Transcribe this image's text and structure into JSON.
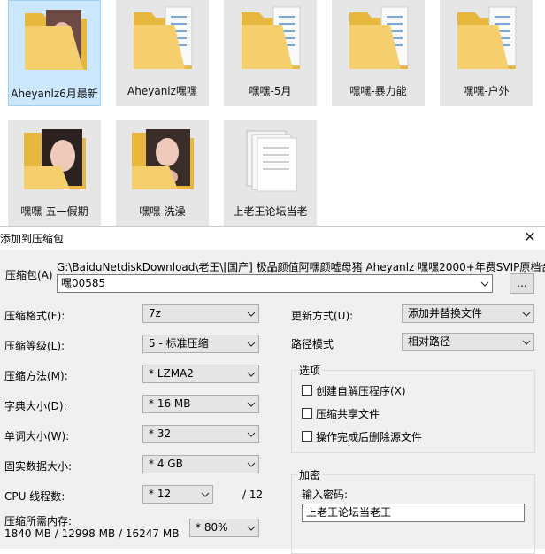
{
  "explorer": {
    "items": [
      {
        "label": "Aheyanlz6月最新",
        "icon": "folder-photo-icon"
      },
      {
        "label": "Aheyanlz嘿嘿",
        "icon": "folder-doc-icon"
      },
      {
        "label": "嘿嘿-5月",
        "icon": "folder-doc-icon"
      },
      {
        "label": "嘿嘿-暴力能",
        "icon": "folder-doc-icon"
      },
      {
        "label": "嘿嘿-户外",
        "icon": "folder-doc-icon"
      },
      {
        "label": "嘿嘿-五一假期",
        "icon": "folder-photo-icon"
      },
      {
        "label": "嘿嘿-洗澡",
        "icon": "folder-photo-icon"
      },
      {
        "label": "上老王论坛当老",
        "icon": "file-stack-icon"
      }
    ]
  },
  "dialog": {
    "title": "添加到压缩包",
    "archive_label": "压缩包(A)",
    "archive_path": "G:\\BaiduNetdiskDownload\\老王\\[国产] 极品颜值阿嘿颜嘘母猪 Aheyanlz 嘿嘿2000+年费SVIP原档合集【",
    "archive_name": "嘿00585",
    "browse_button": "...",
    "format_label": "压缩格式(F):",
    "format_value": "7z",
    "level_label": "压缩等级(L):",
    "level_value": "5 - 标准压缩",
    "method_label": "压缩方法(M):",
    "method_value": "*  LZMA2",
    "dict_label": "字典大小(D):",
    "dict_value": "*  16 MB",
    "word_label": "单词大小(W):",
    "word_value": "*  32",
    "solid_label": "固实数据大小:",
    "solid_value": "*  4 GB",
    "cpu_label": "CPU 线程数:",
    "cpu_value": "*  12",
    "cpu_total": "/ 12",
    "memory_label": "压缩所需内存:",
    "memory_value": "1840 MB / 12998 MB / 16247 MB",
    "memory_percent": "*  80%",
    "update_label": "更新方式(U):",
    "update_value": "添加并替换文件",
    "pathmode_label": "路径模式",
    "pathmode_value": "相对路径",
    "options_title": "选项",
    "opt_sfx": "创建自解压程序(X)",
    "opt_shared": "压缩共享文件",
    "opt_delete": "操作完成后删除源文件",
    "encrypt_title": "加密",
    "password_label": "输入密码:",
    "password_value": "上老王论坛当老王"
  }
}
